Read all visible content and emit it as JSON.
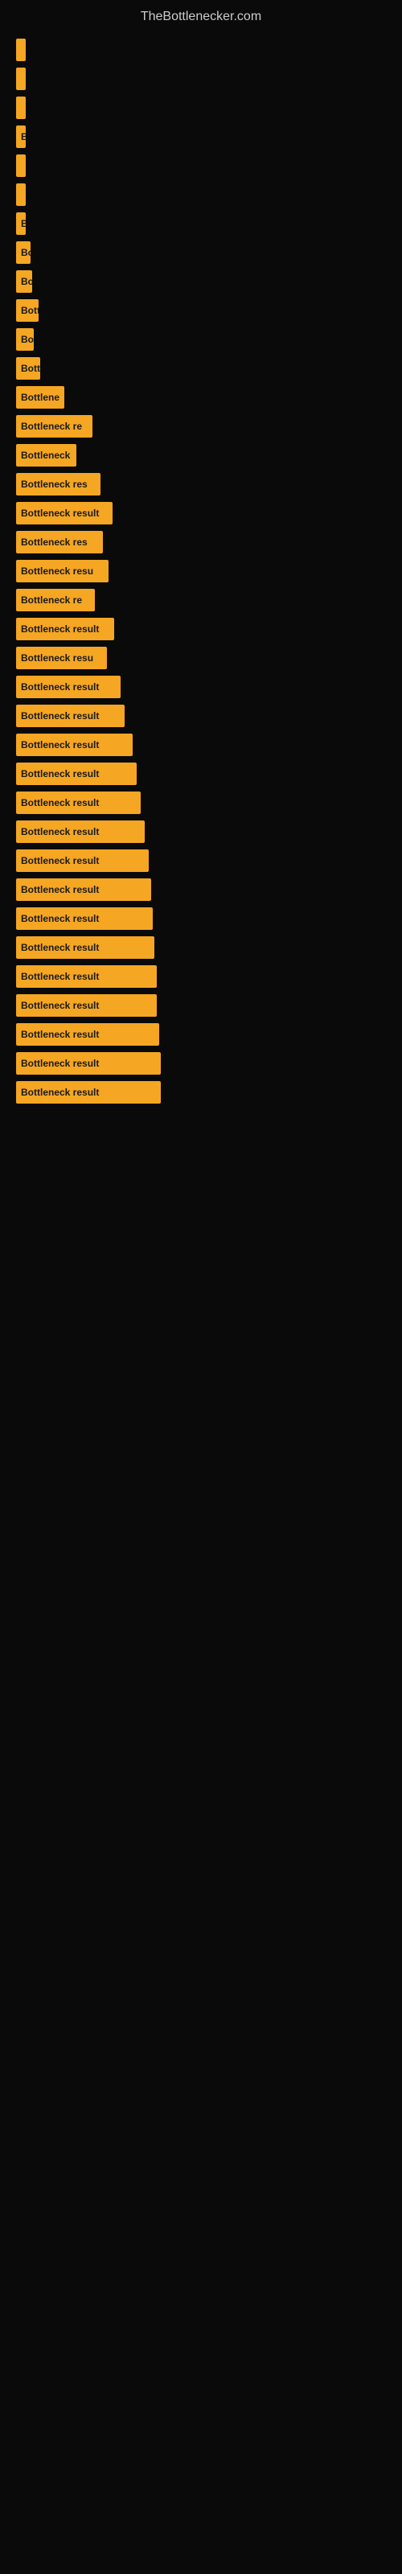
{
  "site": {
    "title": "TheBottlenecker.com"
  },
  "results": [
    {
      "label": "",
      "width": 2
    },
    {
      "label": "",
      "width": 4
    },
    {
      "label": "",
      "width": 4
    },
    {
      "label": "B",
      "width": 10
    },
    {
      "label": "",
      "width": 4
    },
    {
      "label": "",
      "width": 4
    },
    {
      "label": "B",
      "width": 10
    },
    {
      "label": "Bo",
      "width": 18
    },
    {
      "label": "Bo",
      "width": 20
    },
    {
      "label": "Bott",
      "width": 28
    },
    {
      "label": "Bo",
      "width": 22
    },
    {
      "label": "Bott",
      "width": 30
    },
    {
      "label": "Bottlene",
      "width": 60
    },
    {
      "label": "Bottleneck re",
      "width": 95
    },
    {
      "label": "Bottleneck",
      "width": 75
    },
    {
      "label": "Bottleneck res",
      "width": 105
    },
    {
      "label": "Bottleneck result",
      "width": 120
    },
    {
      "label": "Bottleneck res",
      "width": 108
    },
    {
      "label": "Bottleneck resu",
      "width": 115
    },
    {
      "label": "Bottleneck re",
      "width": 98
    },
    {
      "label": "Bottleneck result",
      "width": 122
    },
    {
      "label": "Bottleneck resu",
      "width": 113
    },
    {
      "label": "Bottleneck result",
      "width": 130
    },
    {
      "label": "Bottleneck result",
      "width": 135
    },
    {
      "label": "Bottleneck result",
      "width": 145
    },
    {
      "label": "Bottleneck result",
      "width": 150
    },
    {
      "label": "Bottleneck result",
      "width": 155
    },
    {
      "label": "Bottleneck result",
      "width": 160
    },
    {
      "label": "Bottleneck result",
      "width": 165
    },
    {
      "label": "Bottleneck result",
      "width": 168
    },
    {
      "label": "Bottleneck result",
      "width": 170
    },
    {
      "label": "Bottleneck result",
      "width": 172
    },
    {
      "label": "Bottleneck result",
      "width": 175
    },
    {
      "label": "Bottleneck result",
      "width": 175
    },
    {
      "label": "Bottleneck result",
      "width": 178
    },
    {
      "label": "Bottleneck result",
      "width": 180
    },
    {
      "label": "Bottleneck result",
      "width": 180
    }
  ]
}
